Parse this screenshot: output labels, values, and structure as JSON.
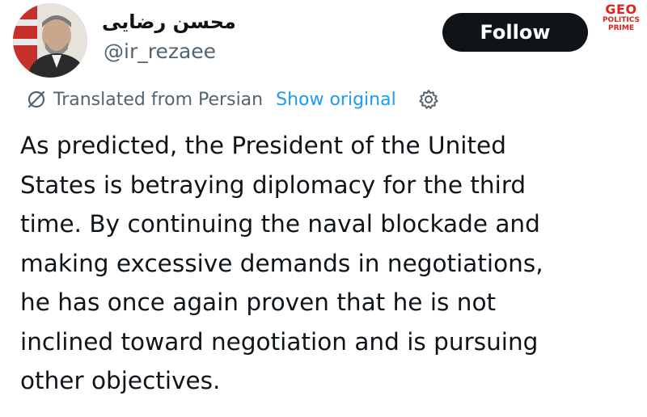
{
  "author": {
    "display_name": "محسن رضایی",
    "handle": "@ir_rezaee"
  },
  "actions": {
    "follow_label": "Follow"
  },
  "watermark": {
    "main": "GEO",
    "line1": "POLITICS",
    "line2": "PRIME"
  },
  "translation": {
    "label": "Translated from Persian",
    "show_original_label": "Show original",
    "icon": "translate-icon",
    "settings_icon": "gear-icon"
  },
  "tweet": {
    "lines": [
      "As predicted, the President of the United",
      "States is betraying diplomacy for the third",
      "time. By continuing the naval blockade and",
      "making excessive demands in negotiations,",
      "he has once again proven that he is not",
      "inclined toward negotiation and is pursuing",
      "other objectives."
    ]
  },
  "colors": {
    "text": "#0f1419",
    "secondary": "#536471",
    "link": "#1d9bf0",
    "button_bg": "#0f1419",
    "watermark": "#d7261e"
  }
}
